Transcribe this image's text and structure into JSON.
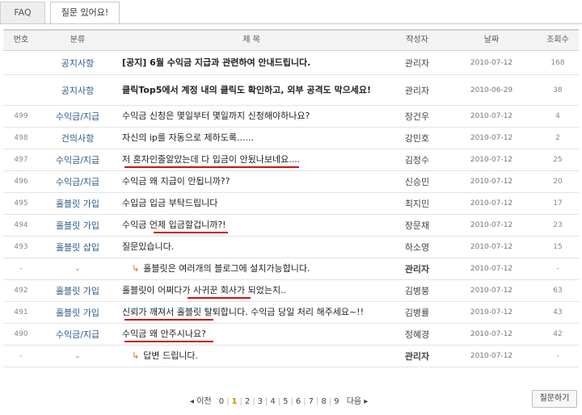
{
  "tabs": [
    {
      "label": "FAQ",
      "active": false
    },
    {
      "label": "질문 있어요!",
      "active": true
    }
  ],
  "table": {
    "headers": {
      "num": "번호",
      "cat": "분류",
      "title": "제   목",
      "author": "작성자",
      "date": "날짜",
      "views": "조회수"
    },
    "rows": [
      {
        "num": "",
        "cat": "공지사항",
        "title": "[공지] 6월 수익금 지급과 관련하여 안내드립니다.",
        "author": "관리자",
        "date": "2010-07-12",
        "views": "168"
      },
      {
        "num": "",
        "cat": "공지사항",
        "title": "클릭Top5에서 계정 내의 클릭도 확인하고, 외부 공격도 막으세요!",
        "author": "관리자",
        "date": "2010-06-29",
        "views": "38"
      },
      {
        "num": "499",
        "cat": "수익금/지급",
        "title": "수익금 신청은 몇일부터 몇일까지 신청해야하나요?",
        "author": "장건우",
        "date": "2010-07-12",
        "views": "4"
      },
      {
        "num": "498",
        "cat": "건의사항",
        "title": "자신의 ip를 자동으로 제하도록......",
        "author": "강민호",
        "date": "2010-07-12",
        "views": "2"
      },
      {
        "num": "497",
        "cat": "수익금/지급",
        "title": "저 혼자인줄알았는데 다 입금이 안됬나보네요....",
        "author": "김정수",
        "date": "2010-07-12",
        "views": "25"
      },
      {
        "num": "496",
        "cat": "수익금/지급",
        "title": "수익금 왜 지급이 안됩니까??",
        "author": "신승민",
        "date": "2010-07-12",
        "views": "20"
      },
      {
        "num": "495",
        "cat": "홀블릿 가입",
        "title": "수입금 입금 부탁드립니다",
        "author": "최지민",
        "date": "2010-07-12",
        "views": "17"
      },
      {
        "num": "494",
        "cat": "홀블릿 가입",
        "title": "수익금 언제 입금할겁니까?!",
        "author": "장문채",
        "date": "2010-07-12",
        "views": "23"
      },
      {
        "num": "493",
        "cat": "홀블릿 삽입",
        "title": "질문있습니다.",
        "author": "하소영",
        "date": "2010-07-12",
        "views": "15"
      },
      {
        "num": "-",
        "cat": "-",
        "title": "홀블릿은 여러개의 블로그에 설치가능합니다.",
        "author": "관리자",
        "date": "2010-07-12",
        "views": "-",
        "reply": true
      },
      {
        "num": "492",
        "cat": "홀블릿 가입",
        "title": "홀블릿이 어쩌다가 사귀꾼 회사가 되었는지..",
        "author": "김병붕",
        "date": "2010-07-12",
        "views": "63"
      },
      {
        "num": "491",
        "cat": "홀블릿 가입",
        "title": "신뢰가 깨져서 홀블릿 탈퇴합니다. 수익금 당일 처리 해주세요~!!",
        "author": "김병률",
        "date": "2010-07-12",
        "views": "43"
      },
      {
        "num": "490",
        "cat": "수익금/지급",
        "title": "수익금 왜 안주시나요?",
        "author": "정혜경",
        "date": "2010-07-12",
        "views": "42"
      },
      {
        "num": "-",
        "cat": "-",
        "title": "답변 드립니다.",
        "author": "관리자",
        "date": "2010-07-12",
        "views": "-",
        "reply": true
      }
    ]
  },
  "pager": {
    "prev": "◂ 이전",
    "pages": [
      "0",
      "1",
      "2",
      "3",
      "4",
      "5",
      "6",
      "7",
      "8",
      "9"
    ],
    "current": "1",
    "next": "다음 ▸"
  },
  "ask_button": "질문하기",
  "colors": {
    "underline": "#cc1111",
    "category_link": "#2a5a8a",
    "current_page": "#d28f00"
  }
}
